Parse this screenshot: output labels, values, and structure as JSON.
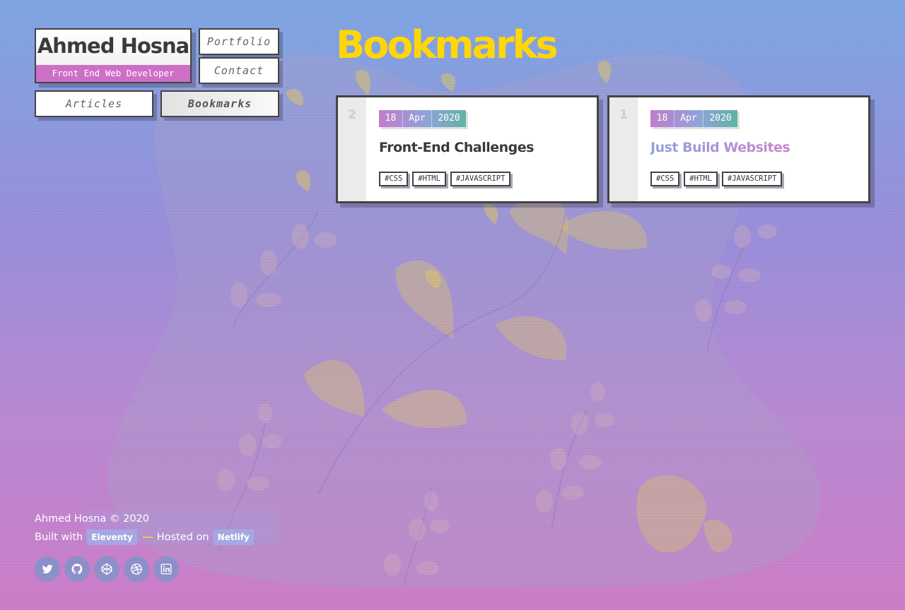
{
  "header": {
    "name": "Ahmed Hosna",
    "role": "Front End Web Developer",
    "nav": {
      "portfolio": "Portfolio",
      "contact": "Contact",
      "articles": "Articles",
      "bookmarks": "Bookmarks"
    },
    "active_nav": "Bookmarks"
  },
  "page": {
    "title": "Bookmarks"
  },
  "bookmarks": [
    {
      "index": "2",
      "day": "18",
      "month": "Apr",
      "year": "2020",
      "title": "Front-End Challenges",
      "tags": [
        "#CSS",
        "#HTML",
        "#JAVASCRIPT"
      ]
    },
    {
      "index": "1",
      "day": "18",
      "month": "Apr",
      "year": "2020",
      "title": "Just Build Websites",
      "tags": [
        "#CSS",
        "#HTML",
        "#JAVASCRIPT"
      ]
    }
  ],
  "footer": {
    "copyright": "Ahmed Hosna © 2020",
    "built_with_label": "Built with",
    "built_with_link": "Eleventy",
    "hosted_on_label": "Hosted on",
    "hosted_on_link": "Netlify",
    "socials": [
      "twitter-icon",
      "github-icon",
      "codepen-icon",
      "dribbble-icon",
      "linkedin-icon"
    ]
  },
  "colors": {
    "accent_yellow": "#ffd60a",
    "accent_pink": "#cd6fc6",
    "border": "#444444",
    "bg_top": "#7fa7e3",
    "bg_bottom": "#cd7ec8"
  }
}
